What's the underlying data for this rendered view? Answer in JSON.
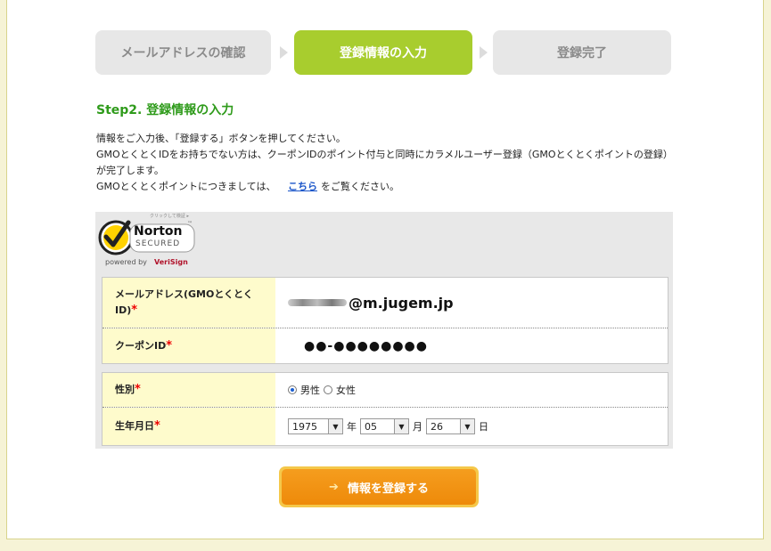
{
  "steps": [
    {
      "label": "メールアドレスの確認",
      "active": false
    },
    {
      "label": "登録情報の入力",
      "active": true
    },
    {
      "label": "登録完了",
      "active": false
    }
  ],
  "heading": "Step2. 登録情報の入力",
  "intro": {
    "line1": "情報をご入力後、「登録する」ボタンを押してください。",
    "line2": "GMOとくとくIDをお持ちでない方は、クーポンIDのポイント付与と同時にカラメルユーザー登録（GMOとくとくポイントの登録）が完了します。",
    "line3_before": "GMOとくとくポイントにつきましては、",
    "line3_link": "こちら",
    "line3_after": "をご覧ください。"
  },
  "norton": {
    "top_text": "クリックして検証 ▸",
    "brand": "Norton",
    "secured": "SECURED",
    "powered_by": "powered by",
    "verisign": "VeriSign",
    "tm": "™"
  },
  "form": {
    "email_label": "メールアドレス(GMOとくとくID)",
    "email_value": "@m.jugem.jp",
    "coupon_label": "クーポンID",
    "coupon_value": "●●-●●●●●●●●",
    "gender_label": "性別",
    "gender_options": [
      "男性",
      "女性"
    ],
    "gender_selected": "男性",
    "birth_label": "生年月日",
    "year": "1975",
    "year_unit": "年",
    "month": "05",
    "month_unit": "月",
    "day": "26",
    "day_unit": "日",
    "required_mark": "*"
  },
  "submit": {
    "label": "情報を登録する",
    "icon": "arrow-right-icon"
  },
  "colors": {
    "accent": "#a8cd2e",
    "heading": "#2f9b1b",
    "button": "#ee8a0a",
    "required": "#e00000",
    "label_bg": "#fefbcc"
  }
}
